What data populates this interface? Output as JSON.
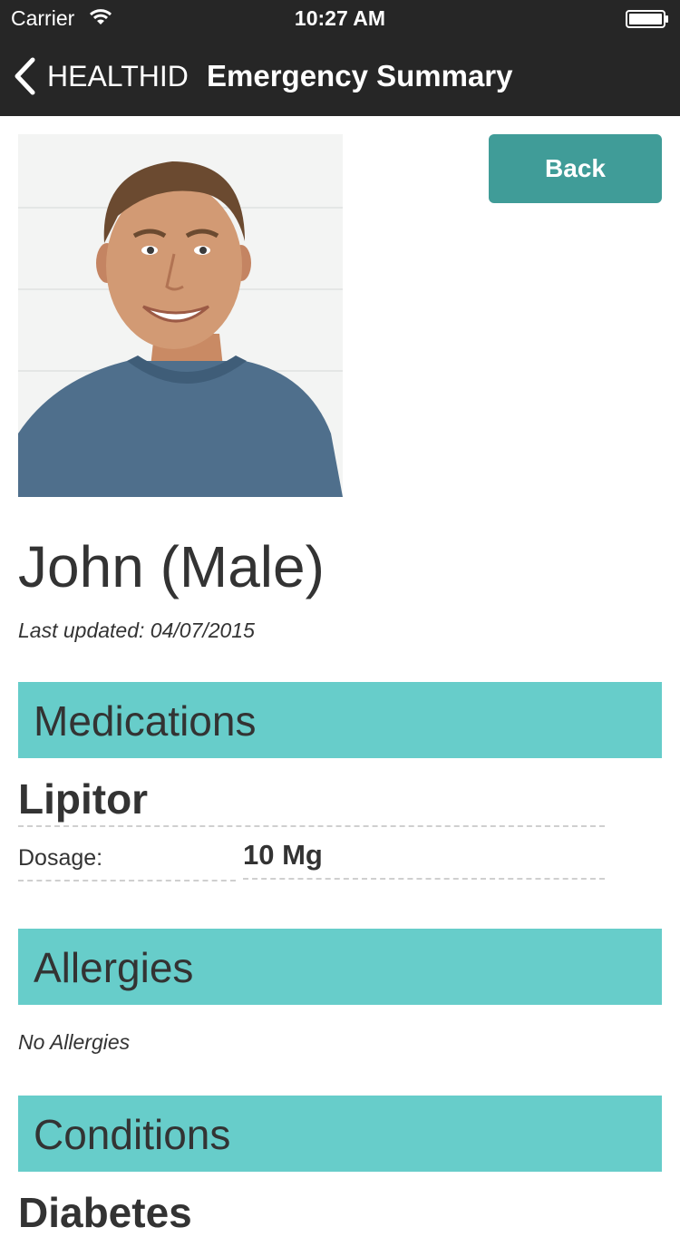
{
  "status_bar": {
    "carrier": "Carrier",
    "time": "10:27 AM",
    "icons": [
      "wifi-icon",
      "battery-icon"
    ]
  },
  "nav": {
    "back_label": "HEALTHID",
    "title": "Emergency Summary",
    "icons": [
      "chevron-left-icon"
    ]
  },
  "profile": {
    "photo": "portrait of smiling man in blue sweater",
    "back_button": "Back",
    "name": "John (Male)",
    "last_updated": "Last updated: 04/07/2015"
  },
  "sections": {
    "medications": {
      "title": "Medications",
      "items": [
        {
          "name": "Lipitor",
          "dosage_label": "Dosage:",
          "dosage_value": "10 Mg"
        }
      ]
    },
    "allergies": {
      "title": "Allergies",
      "empty_text": "No Allergies"
    },
    "conditions": {
      "title": "Conditions",
      "items": [
        {
          "name": "Diabetes"
        }
      ]
    }
  },
  "colors": {
    "nav_background": "#262626",
    "section_header": "#67cdca",
    "back_button": "#409c98",
    "text": "#333333"
  }
}
